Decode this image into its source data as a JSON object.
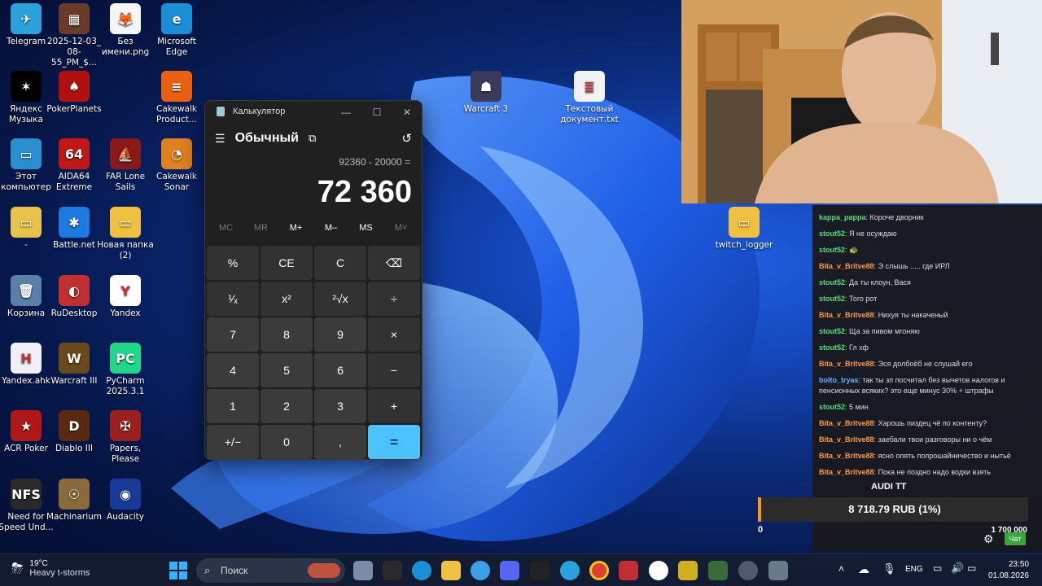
{
  "desktop_icons": [
    {
      "label": "Telegram",
      "color": "#2aa1da",
      "glyph": "✈"
    },
    {
      "label": "2025-12-03_ 08-55_PM_$...",
      "color": "#6a3b2a",
      "glyph": "▦"
    },
    {
      "label": "Без имени.png",
      "color": "#f5f5f5",
      "glyph": "🦊"
    },
    {
      "label": "Microsoft Edge",
      "color": "#1a8fd6",
      "glyph": "e"
    },
    {
      "label": "Яндекс Музыка",
      "color": "#000000",
      "glyph": "✶"
    },
    {
      "label": "PokerPlanets",
      "color": "#b01010",
      "glyph": "♠"
    },
    {
      "label": "Cakewalk Product...",
      "color": "#e86010",
      "glyph": "≡"
    },
    {
      "label": "Этот компьютер",
      "color": "#2a8fd0",
      "glyph": "▭"
    },
    {
      "label": "AIDA64 Extreme",
      "color": "#c01818",
      "glyph": "64"
    },
    {
      "label": "FAR Lone Sails",
      "color": "#8a1a1a",
      "glyph": "⛵"
    },
    {
      "label": "Cakewalk Sonar",
      "color": "#e08020",
      "glyph": "◔"
    },
    {
      "label": "-",
      "color": "#e8c24a",
      "glyph": "▭"
    },
    {
      "label": "Battle.net",
      "color": "#1c7ae0",
      "glyph": "✱"
    },
    {
      "label": "Новая папка (2)",
      "color": "#f0c040",
      "glyph": "▭"
    },
    {
      "label": "Корзина",
      "color": "#5a7fa8",
      "glyph": "🗑"
    },
    {
      "label": "RuDesktop",
      "color": "#c03030",
      "glyph": "◐"
    },
    {
      "label": "Yandex",
      "color": "#ffffff",
      "glyph": "Y"
    },
    {
      "label": "Yandex.ahk",
      "color": "#f0eef8",
      "glyph": "H"
    },
    {
      "label": "Warcraft III",
      "color": "#6a4a1a",
      "glyph": "W"
    },
    {
      "label": "PyCharm 2025.3.1",
      "color": "#21d789",
      "glyph": "PC"
    },
    {
      "label": "ACR Poker",
      "color": "#b01818",
      "glyph": "★"
    },
    {
      "label": "Diablo III",
      "color": "#5a2a10",
      "glyph": "D"
    },
    {
      "label": "Papers, Please",
      "color": "#9a2020",
      "glyph": "✠"
    },
    {
      "label": "Need for Speed Und...",
      "color": "#2a2a2a",
      "glyph": "NFS"
    },
    {
      "label": "Machinarium",
      "color": "#8a6a3a",
      "glyph": "☉"
    },
    {
      "label": "Audacity",
      "color": "#1a3a9a",
      "glyph": "◉"
    },
    {
      "label": "Warcraft 3",
      "color": "#3a3a5a",
      "glyph": "☗"
    },
    {
      "label": "Текстовый документ.txt",
      "color": "#f2f2f2",
      "glyph": "≣"
    },
    {
      "label": "twitch_logger",
      "color": "#f0c040",
      "glyph": "▭"
    }
  ],
  "calculator": {
    "window_title": "Калькулятор",
    "mode": "Обычный",
    "expression": "92360 - 20000 =",
    "result": "72 360",
    "memory": [
      "MC",
      "MR",
      "M+",
      "M–",
      "MS",
      "M˅"
    ],
    "buttons": [
      "%",
      "CE",
      "C",
      "⌫",
      "¹⁄ₓ",
      "x²",
      "²√x",
      "÷",
      "7",
      "8",
      "9",
      "×",
      "4",
      "5",
      "6",
      "−",
      "1",
      "2",
      "3",
      "+",
      "+/−",
      "0",
      ",",
      "="
    ]
  },
  "chat": {
    "messages": [
      {
        "user": "kappa_pappa",
        "text": "Короче дворник",
        "cls": "u1"
      },
      {
        "user": "stout52",
        "text": "Я не осуждаю",
        "cls": "u1"
      },
      {
        "user": "stout52",
        "text": "🐢",
        "cls": "u1"
      },
      {
        "user": "Bita_v_Britve88",
        "text": "Э слышь ..... где ИРЛ",
        "cls": "u2"
      },
      {
        "user": "stout52",
        "text": "Да ты клоун, Вася",
        "cls": "u1"
      },
      {
        "user": "stout52",
        "text": "Того рот",
        "cls": "u1"
      },
      {
        "user": "Bita_v_Britve88",
        "text": "Нихуя ты накаченый",
        "cls": "u2"
      },
      {
        "user": "stout52",
        "text": "Ща за пивом мгоняю",
        "cls": "u1"
      },
      {
        "user": "stout52",
        "text": "Гл хф",
        "cls": "u1"
      },
      {
        "user": "Bita_v_Britve88",
        "text": "Эся долбоёб не слушай его",
        "cls": "u2"
      },
      {
        "user": "bolto_tryas",
        "text": "так ты зп посчитал без вычетов налогов и пенсионных всяких? это еще минус 30% + штрафы",
        "cls": "u4"
      },
      {
        "user": "stout52",
        "text": "5 мин",
        "cls": "u1"
      },
      {
        "user": "Bita_v_Britve88",
        "text": "Харошь пиздец чё по контенту?",
        "cls": "u2"
      },
      {
        "user": "Bita_v_Britve88",
        "text": "заебали твои разговоры ни о чём",
        "cls": "u2"
      },
      {
        "user": "Bita_v_Britve88",
        "text": "ясно опять попрошайничество и нытьё",
        "cls": "u2"
      },
      {
        "user": "Bita_v_Britve88",
        "text": "Пока не поздно надо водки взять",
        "cls": "u2"
      }
    ],
    "emote_banner": "AUDI TT",
    "goal_amount": "1 700 000",
    "chat_button": "Чат"
  },
  "donation": {
    "text": "8 718.79 RUB (1%)",
    "start": "0"
  },
  "taskbar": {
    "weather_temp": "19°C",
    "weather_desc": "Heavy t-storms",
    "search_placeholder": "Поиск",
    "lang": "ENG",
    "time": "23:50",
    "date": "01.08.2026"
  }
}
